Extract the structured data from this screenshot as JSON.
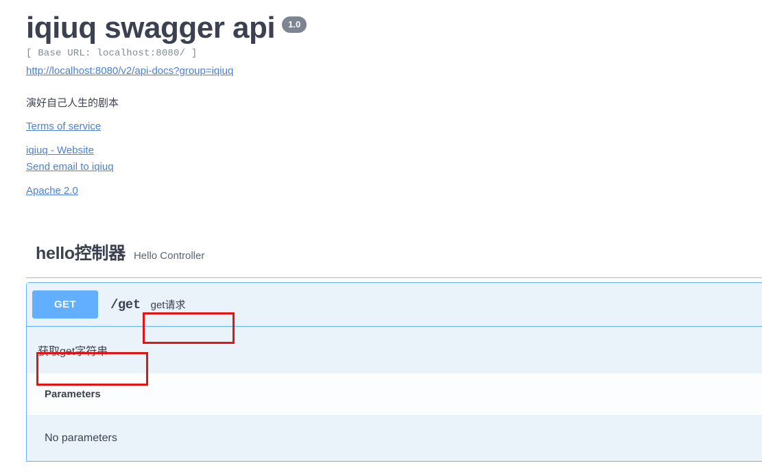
{
  "info": {
    "title": "iqiuq swagger api",
    "version_badge": "1.0",
    "base_url": "[ Base URL: localhost:8080/ ]",
    "docs_url": "http://localhost:8080/v2/api-docs?group=iqiuq",
    "description": "演好自己人生的剧本",
    "links": {
      "terms": "Terms of service",
      "website": "iqiuq - Website",
      "email": "Send email to iqiuq",
      "license": "Apache 2.0"
    }
  },
  "tag": {
    "name": "hello控制器",
    "description": "Hello Controller"
  },
  "operation": {
    "method": "GET",
    "path": "/get",
    "summary": "get请求",
    "description": "获取get字符串",
    "parameters_title": "Parameters",
    "parameters_empty": "No parameters"
  },
  "colors": {
    "method_get": "#61affe",
    "operation_bg": "#ebf3fa",
    "annotation": "#e8110f",
    "link": "#4a7fd6",
    "text": "#3b4151",
    "badge_bg": "#7d8492"
  }
}
